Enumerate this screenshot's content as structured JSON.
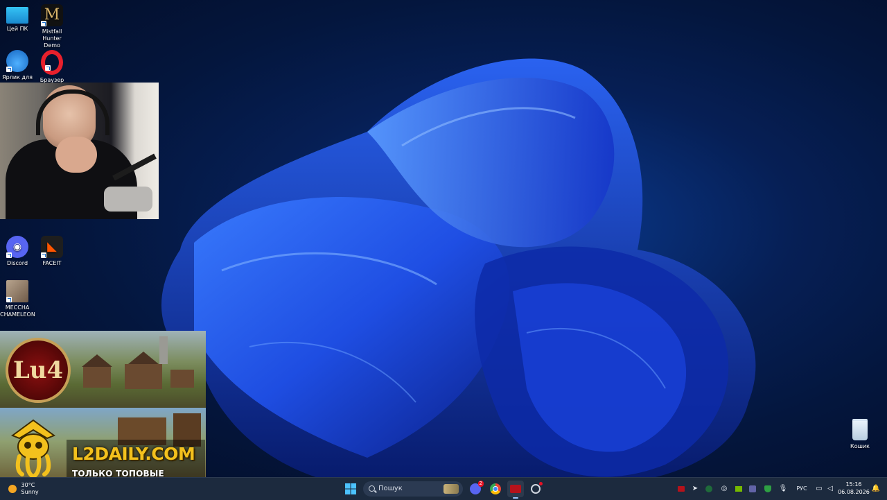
{
  "desktop": {
    "icons": [
      {
        "label": "Цей ПК",
        "icon": "monitor-icon"
      },
      {
        "label": "Mistfall Hunter Demo",
        "icon": "mistfall-icon"
      },
      {
        "label": "Ярлик для",
        "icon": "onedrive-icon"
      },
      {
        "label": "Браузер",
        "icon": "opera-icon"
      },
      {
        "label": "Discord",
        "icon": "discord-icon"
      },
      {
        "label": "FACEIT",
        "icon": "faceit-icon"
      },
      {
        "label": "MECCHA CHAMELEON",
        "icon": "game-icon"
      }
    ],
    "recycle_bin": {
      "label": "Кошик",
      "icon": "recycle-bin-icon"
    }
  },
  "ads": {
    "top": {
      "logo_text": "Lu4"
    },
    "bottom": {
      "site": "L2DAILY.COM",
      "tagline": "ТОЛЬКО ТОПОВЫЕ СЕРВЕРА"
    }
  },
  "taskbar": {
    "weather": {
      "temp": "30°C",
      "condition": "Sunny"
    },
    "search_placeholder": "Пошук",
    "pinned": [
      {
        "icon": "windows-start-icon"
      },
      {
        "icon": "discord-taskbar-icon",
        "badge": "2"
      },
      {
        "icon": "chrome-icon"
      },
      {
        "icon": "app-red-icon"
      },
      {
        "icon": "app-settings-icon"
      }
    ],
    "tray": {
      "language": "РУС",
      "time": "15:16",
      "date": "06.08.2026"
    },
    "colors": {
      "accent": "#1a6fd1",
      "taskbar_bg": "#1c2a3e"
    }
  }
}
